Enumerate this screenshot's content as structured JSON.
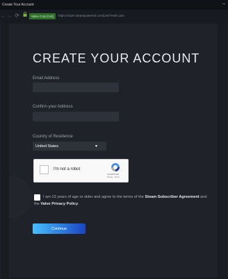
{
  "window": {
    "title": "Create Your Account",
    "minimize_glyph": "–"
  },
  "navbar": {
    "back_glyph": "←",
    "forward_glyph": "→",
    "reload_glyph": "⟳",
    "lock_icon": "lock-icon",
    "cert_badge": "Valve Corp [US]",
    "url": "https://store.steampowered.com/join/?redir=join"
  },
  "form": {
    "heading": "CREATE YOUR ACCOUNT",
    "email_label": "Email Address",
    "email_value": "",
    "confirm_label": "Confirm your Address",
    "confirm_value": "",
    "country_label": "Country of Residence",
    "country_value": "United States",
    "country_caret": "▼",
    "recaptcha": {
      "label": "I'm not a robot",
      "brand": "reCAPTCHA",
      "terms": "Privacy - Terms"
    },
    "agreement": {
      "prefix": "I am 13 years of age or older and agree to the terms of the",
      "ssa": "Steam Subscriber Agreement",
      "mid": "and the",
      "privacy": "Valve Privacy Policy",
      "suffix": "."
    },
    "continue_label": "Continue"
  },
  "colors": {
    "background": "#1b1f27",
    "panel": "#1f2228",
    "field": "#2e323a",
    "accent_start": "#47bfff",
    "accent_end": "#1a44c2",
    "cert_green": "#2f6d2b"
  }
}
